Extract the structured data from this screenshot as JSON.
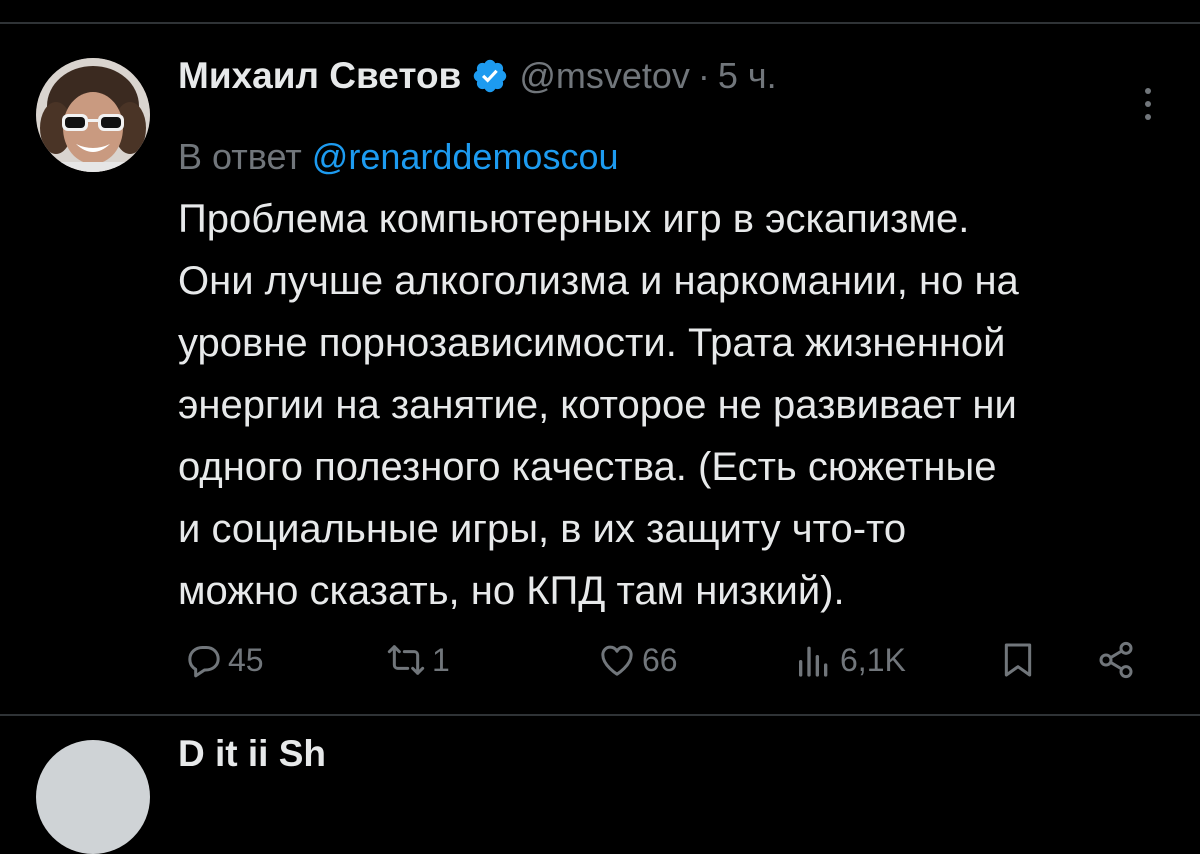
{
  "tweet": {
    "author_name": "Михаил Светов",
    "handle": "@msvetov",
    "separator": "·",
    "time": "5 ч.",
    "reply_prefix": "В ответ",
    "reply_mention": "@renarddemoscou",
    "text_lines": [
      "Проблема компьютерных игр в эскапизме.",
      "Они лучше алкоголизма и наркомании, но на",
      "уровне порнозависимости. Трата жизненной",
      "энергии на занятие, которое не развивает ни",
      "одного полезного качества. (Есть сюжетные",
      "и социальные игры, в их защиту что-то",
      "можно сказать, но КПД там низкий)."
    ],
    "actions": {
      "replies": "45",
      "retweets": "1",
      "likes": "66",
      "views": "6,1K"
    }
  },
  "next_tweet": {
    "author_name_partial": "D  it ii Sh"
  },
  "colors": {
    "background": "#000000",
    "text": "#e7e9ea",
    "secondary": "#71767b",
    "accent": "#1d9bf0",
    "divider": "#2f3336"
  },
  "icons": [
    "verified-badge-icon",
    "more-icon",
    "reply-icon",
    "retweet-icon",
    "like-icon",
    "views-icon",
    "bookmark-icon",
    "share-icon"
  ]
}
